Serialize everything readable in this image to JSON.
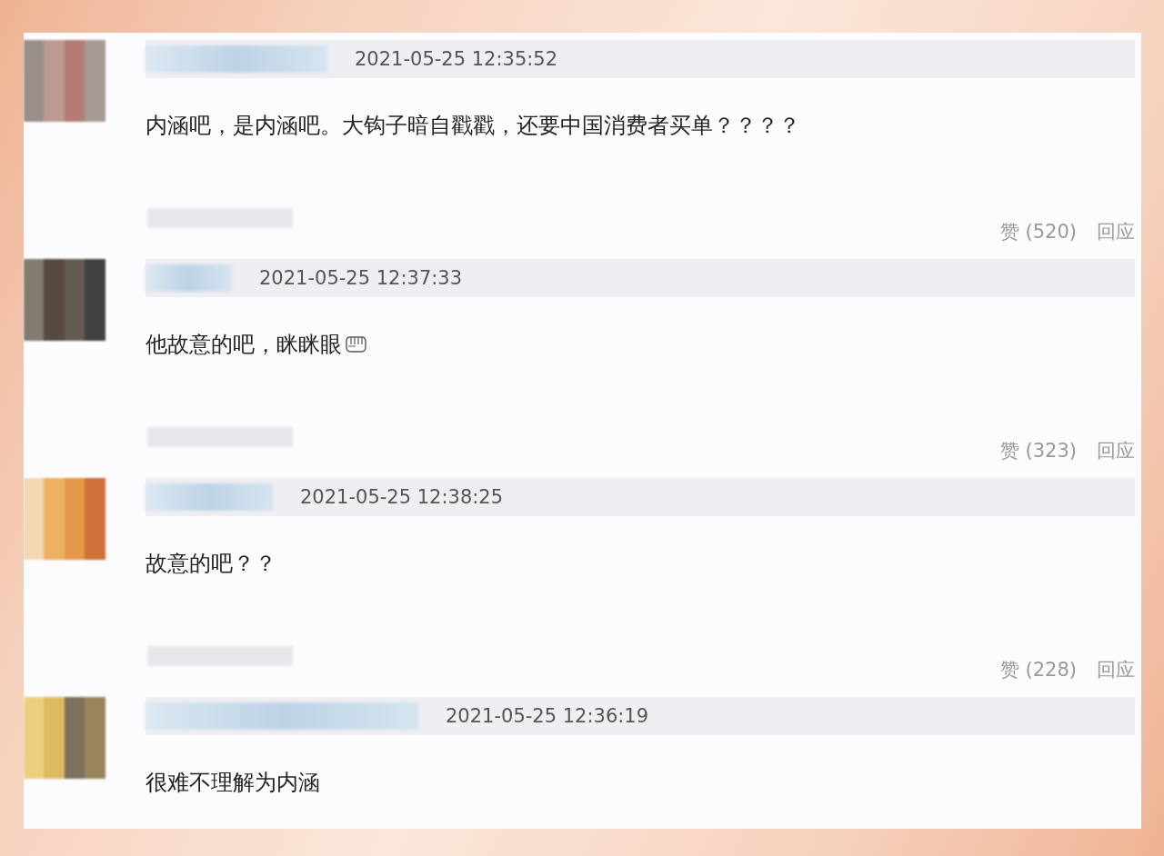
{
  "comments": [
    {
      "time": "2021-05-25 12:35:52",
      "text": "内涵吧，是内涵吧。大钩子暗自戳戳，还要中国消费者买单？？？？",
      "emoji": false,
      "likes": "赞 (520)",
      "reply": "回应"
    },
    {
      "time": "2021-05-25 12:37:33",
      "text": "他故意的吧，眯眯眼",
      "emoji": true,
      "likes": "赞 (323)",
      "reply": "回应"
    },
    {
      "time": "2021-05-25 12:38:25",
      "text": "故意的吧？？",
      "emoji": false,
      "likes": "赞 (228)",
      "reply": "回应"
    },
    {
      "time": "2021-05-25 12:36:19",
      "text": "很难不理解为内涵",
      "emoji": false
    }
  ]
}
